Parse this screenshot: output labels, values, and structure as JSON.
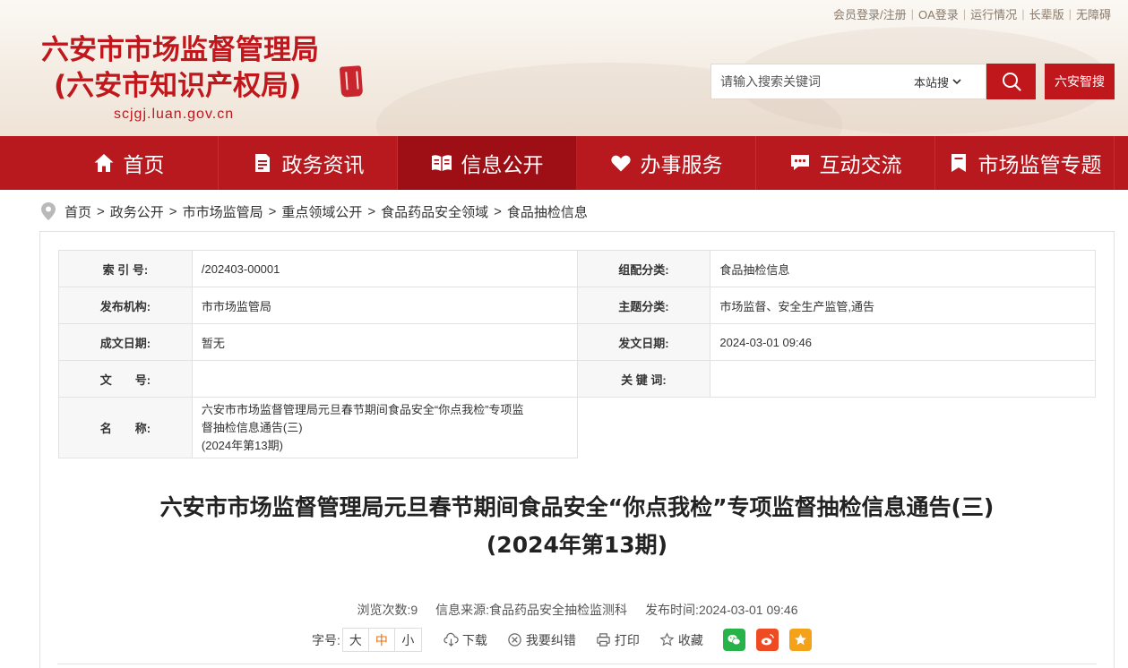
{
  "top_links": [
    "会员登录/注册",
    "OA登录",
    "运行情况",
    "长辈版",
    "无障碍"
  ],
  "site": {
    "title_line1": "六安市市场监督管理局",
    "title_line2": "(六安市知识产权局)",
    "domain": "scjgj.luan.gov.cn"
  },
  "search": {
    "placeholder": "请输入搜索关键词",
    "scope": "本站搜",
    "smart_label": "六安智搜"
  },
  "nav": [
    {
      "label": "首页",
      "icon": "home-icon"
    },
    {
      "label": "政务资讯",
      "icon": "document-icon"
    },
    {
      "label": "信息公开",
      "icon": "open-book-icon"
    },
    {
      "label": "办事服务",
      "icon": "heart-icon"
    },
    {
      "label": "互动交流",
      "icon": "chat-icon"
    },
    {
      "label": "市场监管专题",
      "icon": "bookmark-icon"
    }
  ],
  "breadcrumb": [
    "首页",
    "政务公开",
    "市市场监管局",
    "重点领域公开",
    "食品药品安全领域",
    "食品抽检信息"
  ],
  "meta": {
    "index_label": "索 引 号:",
    "index_value": "/202403-00001",
    "category_label": "组配分类:",
    "category_value": "食品抽检信息",
    "publisher_label": "发布机构:",
    "publisher_value": "市市场监管局",
    "topic_label": "主题分类:",
    "topic_value": "市场监督、安全生产监管,通告",
    "written_label": "成文日期:",
    "written_value": "暂无",
    "issued_label": "发文日期:",
    "issued_value": "2024-03-01 09:46",
    "docno_label": "文　　号:",
    "docno_value": "",
    "keywords_label": "关 键 词:",
    "keywords_value": "",
    "name_label": "名　　称:",
    "name_value_line1": "六安市市场监督管理局元旦春节期间食品安全“你点我检”专项监",
    "name_value_line2": "督抽检信息通告(三)",
    "name_value_line3": "(2024年第13期)"
  },
  "article": {
    "title_line1": "六安市市场监督管理局元旦春节期间食品安全“你点我检”专项监督抽检信息通告(三)",
    "title_line2": "(2024年第13期)",
    "views": "浏览次数:9",
    "source": "信息来源:食品药品安全抽检监测科",
    "published": "发布时间:2024-03-01 09:46"
  },
  "tools": {
    "font_label": "字号:",
    "font_large": "大",
    "font_medium": "中",
    "font_small": "小",
    "download": "下载",
    "report_error": "我要纠错",
    "print": "打印",
    "favorite": "收藏"
  },
  "colors": {
    "brand_red": "#c0171d",
    "nav_red": "#b8191f",
    "nav_active": "#9d0f15",
    "font_active": "#e8700c",
    "wechat": "#28b34a",
    "weibo": "#ee4b22",
    "favorite": "#f4a21a"
  }
}
